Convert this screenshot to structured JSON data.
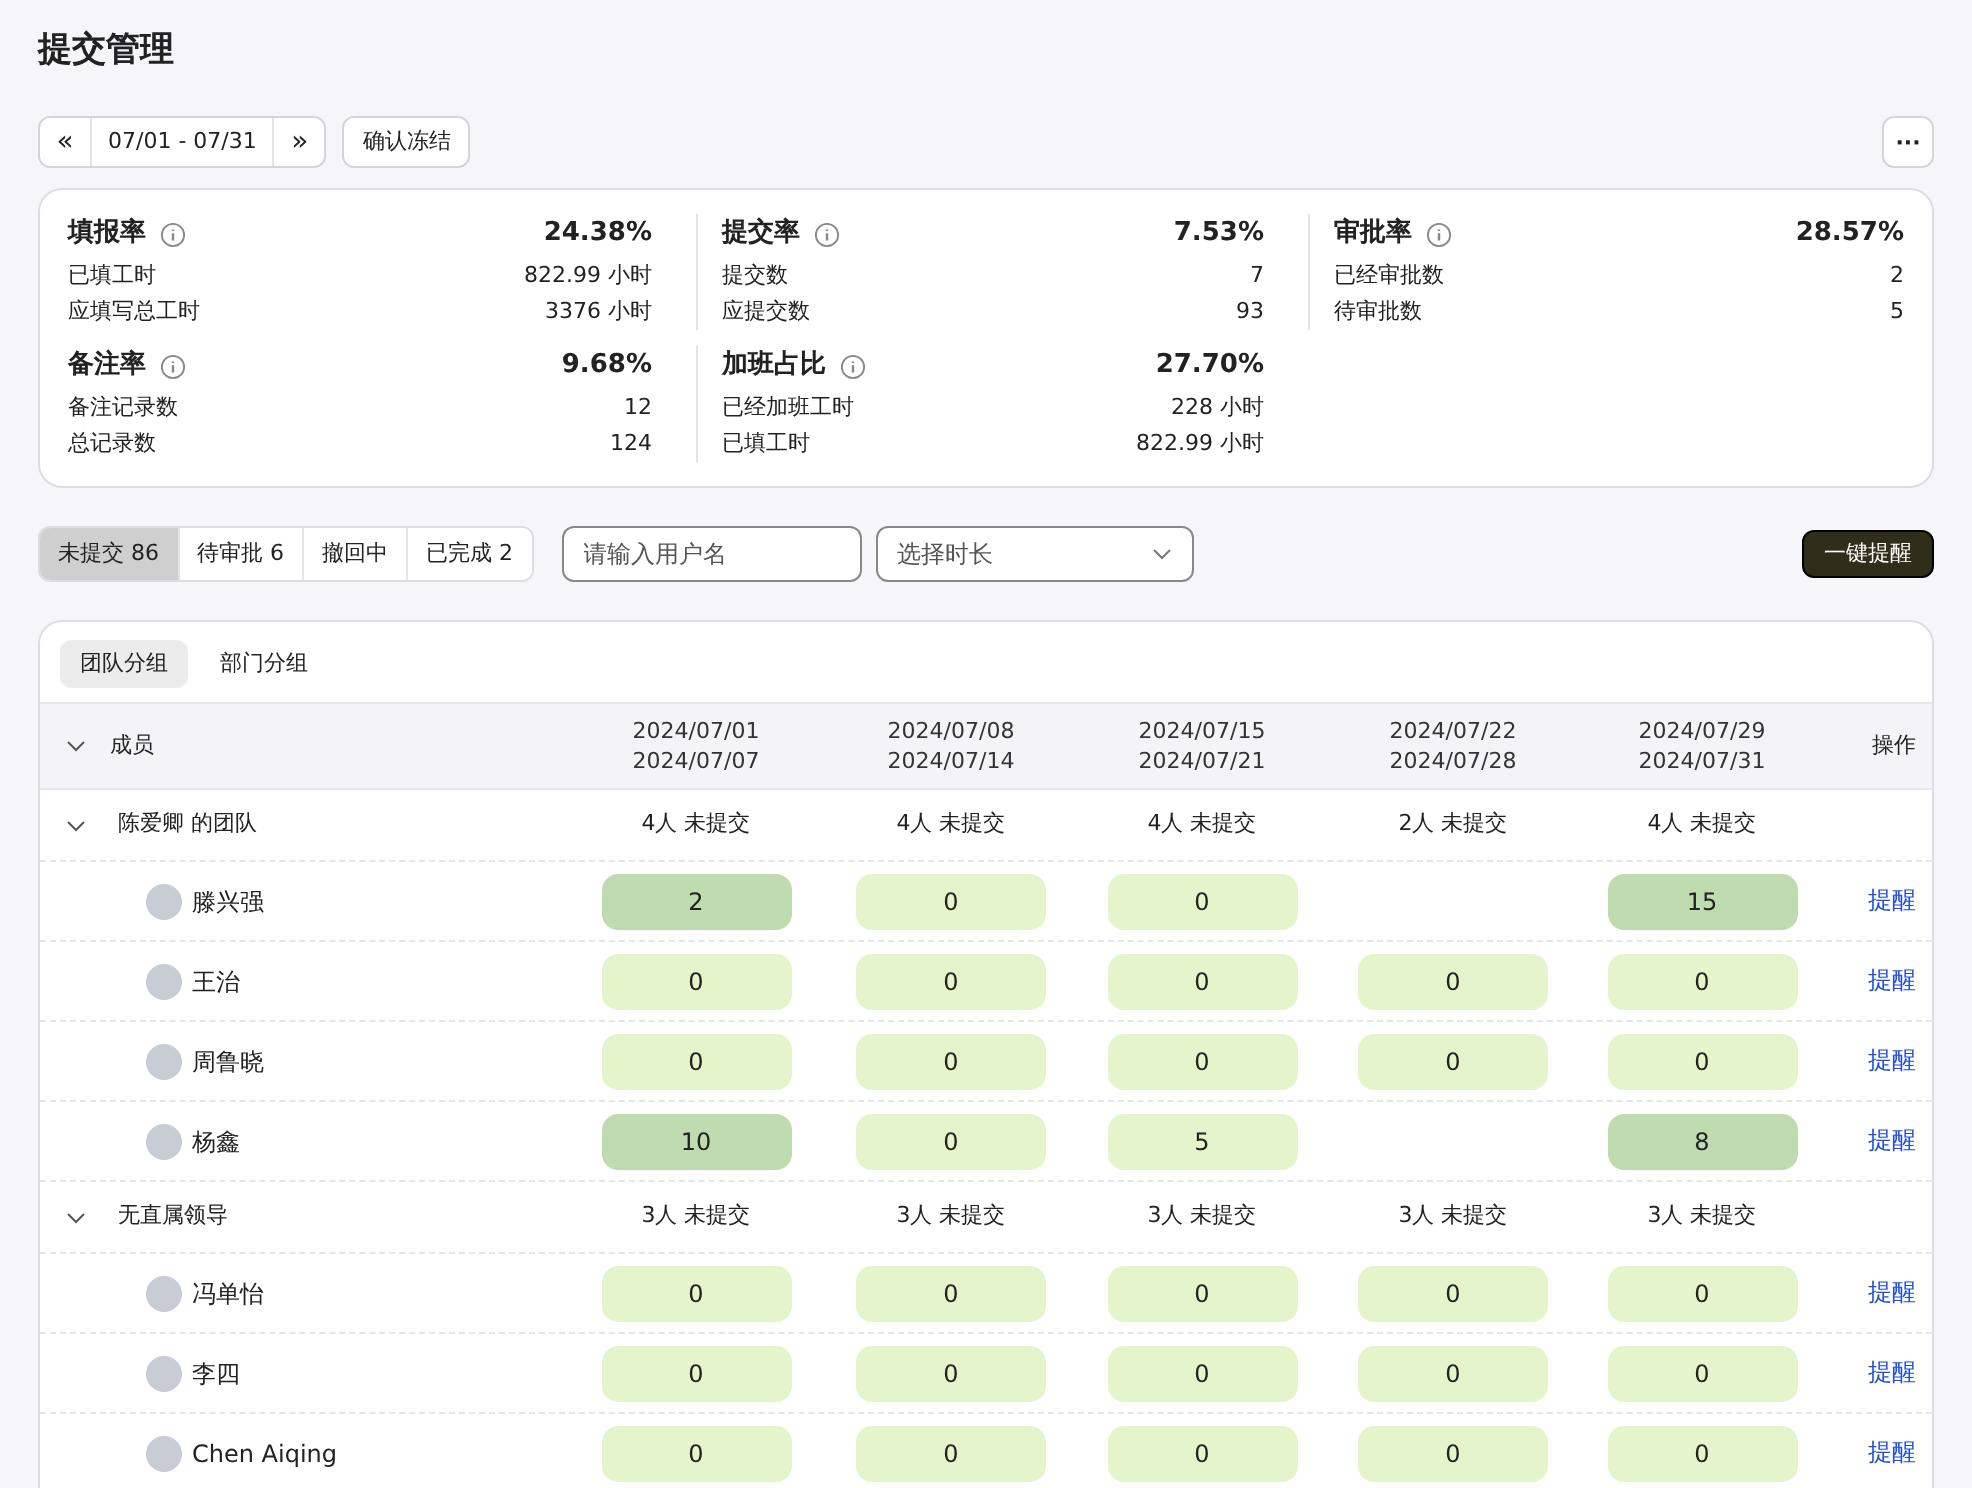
{
  "page_title": "提交管理",
  "toolbar": {
    "prev": "«",
    "range": "07/01 - 07/31",
    "next": "»",
    "confirm_button": "确认冻结",
    "more": "···"
  },
  "stats": [
    {
      "title": "填报率",
      "value": "24.38%",
      "rows": [
        {
          "label": "已填工时",
          "value": "822.99 小时"
        },
        {
          "label": "应填写总工时",
          "value": "3376 小时"
        }
      ]
    },
    {
      "title": "提交率",
      "value": "7.53%",
      "rows": [
        {
          "label": "提交数",
          "value": "7"
        },
        {
          "label": "应提交数",
          "value": "93"
        }
      ]
    },
    {
      "title": "审批率",
      "value": "28.57%",
      "rows": [
        {
          "label": "已经审批数",
          "value": "2"
        },
        {
          "label": "待审批数",
          "value": "5"
        }
      ]
    },
    {
      "title": "备注率",
      "value": "9.68%",
      "rows": [
        {
          "label": "备注记录数",
          "value": "12"
        },
        {
          "label": "总记录数",
          "value": "124"
        }
      ]
    },
    {
      "title": "加班占比",
      "value": "27.70%",
      "rows": [
        {
          "label": "已经加班工时",
          "value": "228 小时"
        },
        {
          "label": "已填工时",
          "value": "822.99 小时"
        }
      ]
    }
  ],
  "status_tabs": [
    {
      "label": "未提交 86",
      "selected": true
    },
    {
      "label": "待审批 6",
      "selected": false
    },
    {
      "label": "撤回中",
      "selected": false
    },
    {
      "label": "已完成 2",
      "selected": false
    }
  ],
  "search": {
    "placeholder": "请输入用户名"
  },
  "duration_select": {
    "placeholder": "选择时长"
  },
  "remind_all_button": "一键提醒",
  "group_tabs": [
    {
      "label": "团队分组",
      "selected": true
    },
    {
      "label": "部门分组",
      "selected": false
    }
  ],
  "table": {
    "member_header": "成员",
    "columns": [
      [
        "2024/07/01",
        "2024/07/07"
      ],
      [
        "2024/07/08",
        "2024/07/14"
      ],
      [
        "2024/07/15",
        "2024/07/21"
      ],
      [
        "2024/07/22",
        "2024/07/28"
      ],
      [
        "2024/07/29",
        "2024/07/31"
      ]
    ],
    "action_header": "操作",
    "groups": [
      {
        "name": "陈爱卿 的团队",
        "expanded": true,
        "counts": [
          "4人 未提交",
          "4人 未提交",
          "4人 未提交",
          "2人 未提交",
          "4人 未提交"
        ],
        "members": [
          {
            "name": "滕兴强",
            "cells": [
              {
                "value": "2",
                "highlighted": true
              },
              {
                "value": "0",
                "highlighted": false
              },
              {
                "value": "0",
                "highlighted": false
              },
              null,
              {
                "value": "15",
                "highlighted": true
              }
            ],
            "action": "提醒"
          },
          {
            "name": "王治",
            "cells": [
              {
                "value": "0",
                "highlighted": false
              },
              {
                "value": "0",
                "highlighted": false
              },
              {
                "value": "0",
                "highlighted": false
              },
              {
                "value": "0",
                "highlighted": false
              },
              {
                "value": "0",
                "highlighted": false
              }
            ],
            "action": "提醒"
          },
          {
            "name": "周鲁晓",
            "cells": [
              {
                "value": "0",
                "highlighted": false
              },
              {
                "value": "0",
                "highlighted": false
              },
              {
                "value": "0",
                "highlighted": false
              },
              {
                "value": "0",
                "highlighted": false
              },
              {
                "value": "0",
                "highlighted": false
              }
            ],
            "action": "提醒"
          },
          {
            "name": "杨鑫",
            "cells": [
              {
                "value": "10",
                "highlighted": true
              },
              {
                "value": "0",
                "highlighted": false
              },
              {
                "value": "5",
                "highlighted": false
              },
              null,
              {
                "value": "8",
                "highlighted": true
              }
            ],
            "action": "提醒"
          }
        ]
      },
      {
        "name": "无直属领导",
        "expanded": true,
        "counts": [
          "3人 未提交",
          "3人 未提交",
          "3人 未提交",
          "3人 未提交",
          "3人 未提交"
        ],
        "members": [
          {
            "name": "冯单怡",
            "cells": [
              {
                "value": "0",
                "highlighted": false
              },
              {
                "value": "0",
                "highlighted": false
              },
              {
                "value": "0",
                "highlighted": false
              },
              {
                "value": "0",
                "highlighted": false
              },
              {
                "value": "0",
                "highlighted": false
              }
            ],
            "action": "提醒"
          },
          {
            "name": "李四",
            "cells": [
              {
                "value": "0",
                "highlighted": false
              },
              {
                "value": "0",
                "highlighted": false
              },
              {
                "value": "0",
                "highlighted": false
              },
              {
                "value": "0",
                "highlighted": false
              },
              {
                "value": "0",
                "highlighted": false
              }
            ],
            "action": "提醒"
          },
          {
            "name": "Chen Aiqing",
            "cells": [
              {
                "value": "0",
                "highlighted": false
              },
              {
                "value": "0",
                "highlighted": false
              },
              {
                "value": "0",
                "highlighted": false
              },
              {
                "value": "0",
                "highlighted": false
              },
              {
                "value": "0",
                "highlighted": false
              }
            ],
            "action": "提醒"
          }
        ]
      }
    ]
  }
}
